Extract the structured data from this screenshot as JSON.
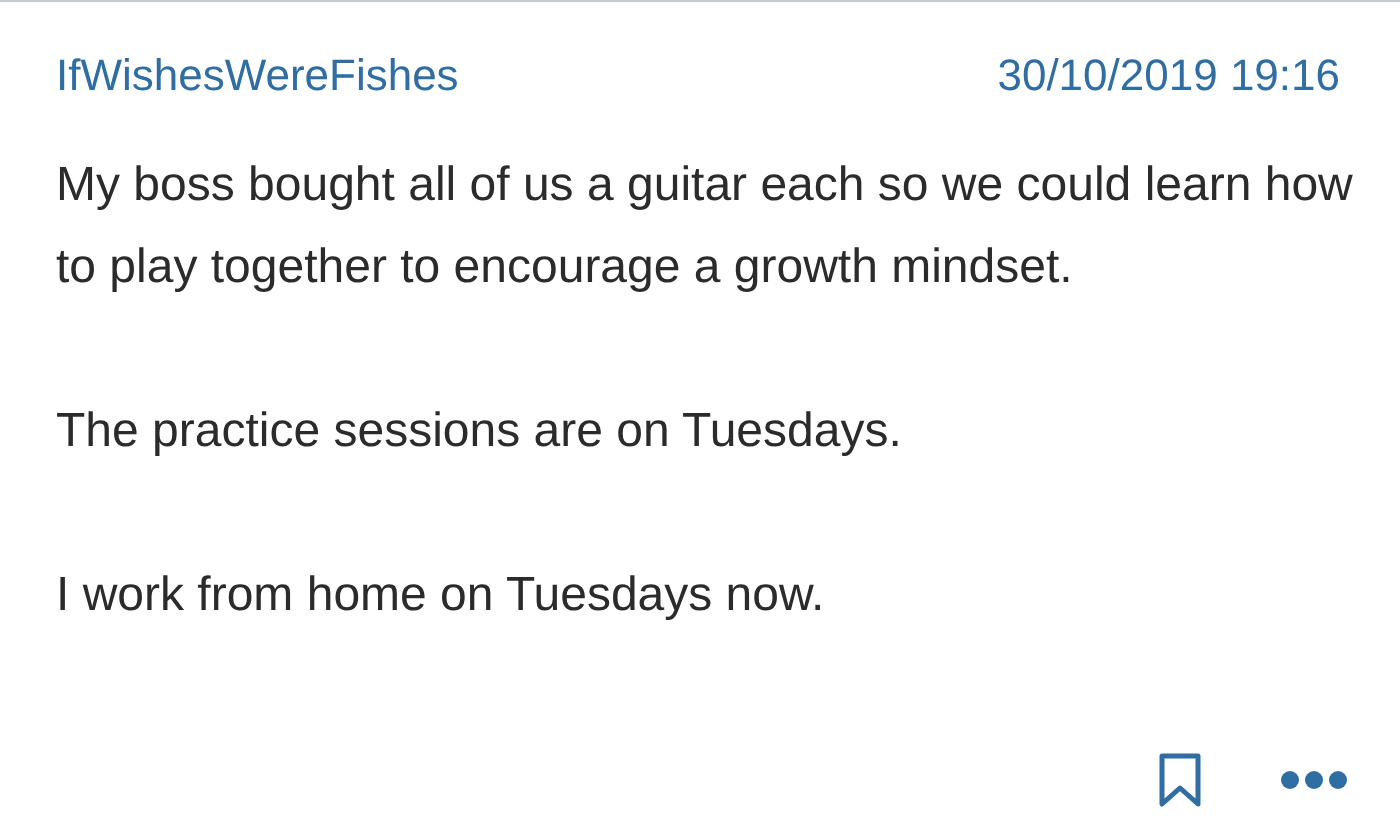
{
  "post": {
    "author": "IfWishesWereFishes",
    "date": "30/10/2019 19:16",
    "paragraphs": [
      "My boss bought all of us a guitar each so we could learn how to play together to encourage a growth mindset.",
      "The practice sessions are on Tuesdays.",
      "I work from home on Tuesdays now."
    ]
  }
}
